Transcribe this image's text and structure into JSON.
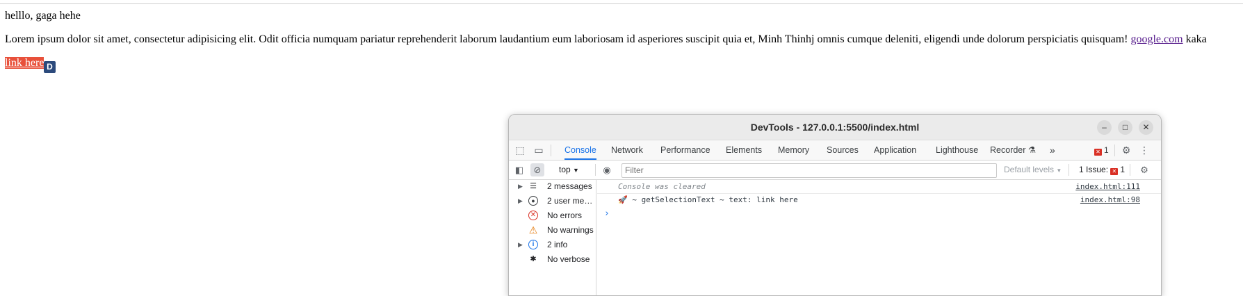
{
  "page": {
    "greeting": "helllo, gaga hehe",
    "paragraph_text": "Lorem ipsum dolor sit amet, consectetur adipisicing elit. Odit officia numquam pariatur reprehenderit laborum laudantium eum laboriosam id asperiores suscipit quia et, Minh Thinhj omnis cumque deleniti, eligendi unde dolorum perspiciatis quisquam!",
    "paragraph_link": "google.com",
    "paragraph_tail": "kaka",
    "selected_link": "link here",
    "extension_badge": "D"
  },
  "devtools": {
    "title": "DevTools - 127.0.0.1:5500/index.html",
    "window_buttons": {
      "minimize": "–",
      "maximize": "□",
      "close": "✕"
    },
    "tabs": [
      "Console",
      "Network",
      "Performance",
      "Elements",
      "Memory",
      "Sources",
      "Application",
      "Lighthouse",
      "Recorder"
    ],
    "active_tab": "Console",
    "more_tabs": "»",
    "error_count": "1",
    "context": "top",
    "filter_placeholder": "Filter",
    "default_levels": "Default levels",
    "issues_label": "1 Issue:",
    "issues_count": "1",
    "sidebar": [
      {
        "label": "2 messages",
        "icon": "list-icon",
        "expandable": true
      },
      {
        "label": "2 user me…",
        "icon": "user-icon",
        "expandable": true
      },
      {
        "label": "No errors",
        "icon": "error-icon",
        "expandable": false
      },
      {
        "label": "No warnings",
        "icon": "warning-icon",
        "expandable": false
      },
      {
        "label": "2 info",
        "icon": "info-icon",
        "expandable": true
      },
      {
        "label": "No verbose",
        "icon": "bug-icon",
        "expandable": false
      }
    ],
    "messages": [
      {
        "text": "Console was cleared",
        "source": "index.html:111"
      },
      {
        "text": "🚀 ~ getSelectionText ~ text: link here",
        "source": "index.html:98"
      }
    ],
    "prompt": "›"
  },
  "colors": {
    "accent": "#1a73e8",
    "selection_bg": "#e8503a",
    "badge_bg": "#2c4a7c",
    "error": "#d93025",
    "visited_link": "#551a8b"
  }
}
